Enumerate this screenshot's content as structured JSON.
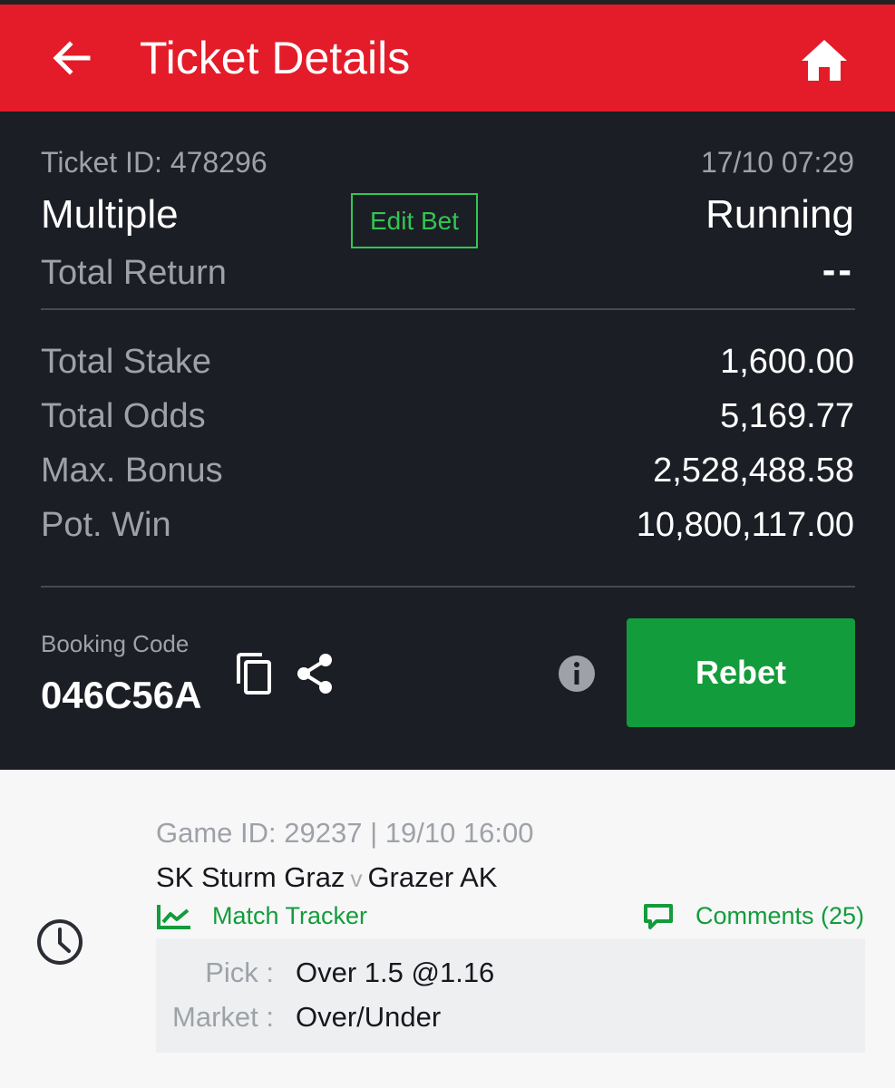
{
  "header": {
    "title": "Ticket Details",
    "back_icon": "arrow-left-icon",
    "home_icon": "home-icon",
    "color": "#e41b28"
  },
  "ticket": {
    "id_label": "Ticket ID: 478296",
    "datetime": "17/10 07:29",
    "type": "Multiple",
    "edit_bet_label": "Edit Bet",
    "status": "Running",
    "total_return_label": "Total Return",
    "total_return_value": "--",
    "rows": [
      {
        "label": "Total Stake",
        "value": "1,600.00"
      },
      {
        "label": "Total Odds",
        "value": "5,169.77"
      },
      {
        "label": "Max. Bonus",
        "value": "2,528,488.58"
      },
      {
        "label": "Pot. Win",
        "value": "10,800,117.00"
      }
    ],
    "booking_code_label": "Booking Code",
    "booking_code": "046C56A",
    "rebet_label": "Rebet",
    "rebet_color": "#139c3b"
  },
  "games": [
    {
      "status_icon": "clock-icon",
      "meta": "Game ID: 29237 | 19/10 16:00",
      "home_team": "SK Sturm Graz",
      "vs": "v",
      "away_team": "Grazer AK",
      "tracker_label": "Match Tracker",
      "comments_label": "Comments (25)",
      "pick_label": "Pick :",
      "pick_value": "Over 1.5 @1.16",
      "market_label": "Market :",
      "market_value": "Over/Under"
    }
  ]
}
